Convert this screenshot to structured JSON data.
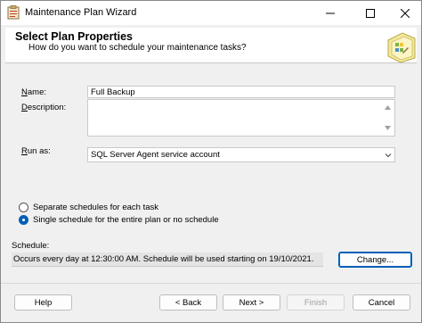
{
  "window": {
    "title": "Maintenance Plan Wizard"
  },
  "header": {
    "title": "Select Plan Properties",
    "subtitle": "How do you want to schedule your maintenance tasks?"
  },
  "form": {
    "name_label_u": "N",
    "name_label_rest": "ame:",
    "name_value": "Full Backup",
    "description_label_u": "D",
    "description_label_rest": "escription:",
    "description_value": "",
    "run_as_label_u": "R",
    "run_as_label_rest": "un as:",
    "run_as_value": "SQL Server Agent service account"
  },
  "schedule_options": {
    "separate_label": "Separate schedules for each task",
    "single_label": "Single schedule for the entire plan or no schedule",
    "selected": "single"
  },
  "schedule": {
    "label": "Schedule:",
    "text": "Occurs every day at 12:30:00 AM. Schedule will be used starting on 19/10/2021.",
    "change_label": "Change..."
  },
  "buttons": {
    "help": "Help",
    "back": "< Back",
    "next": "Next >",
    "finish": "Finish",
    "cancel": "Cancel"
  },
  "icons": {
    "app": "maintenance-plan-icon",
    "header": "wizard-folder-icon"
  },
  "colors": {
    "accent": "#005fb8"
  }
}
